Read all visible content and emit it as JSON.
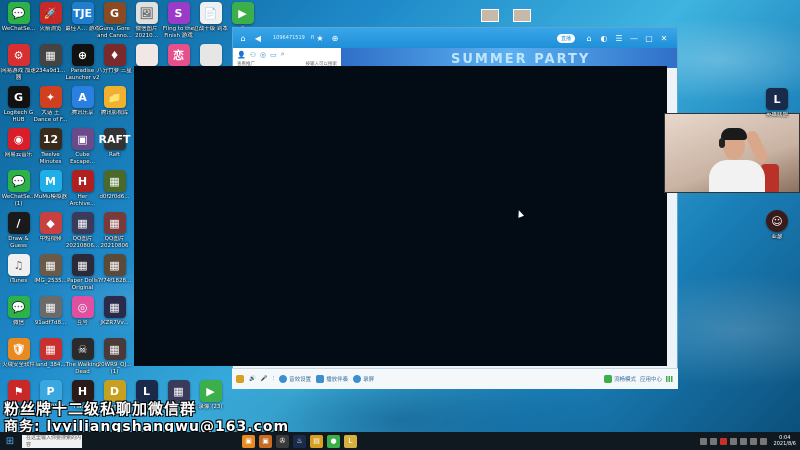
{
  "desktop_icons": [
    {
      "label": "WeChatSe...",
      "color": "#2db24a",
      "glyph": "💬"
    },
    {
      "label": "火箭浏览",
      "color": "#c82828",
      "glyph": "🚀"
    },
    {
      "label": "最佳人... 游戏",
      "color": "#1f7ed0",
      "glyph": "TJE"
    },
    {
      "label": "Guns, Gore and Canno...",
      "color": "#8a4a22",
      "glyph": "G"
    },
    {
      "label": "微信图片 20210...",
      "color": "#e0e0e0",
      "glyph": "🖼"
    },
    {
      "label": "Fling to the Finish 游戏",
      "color": "#9b3cc8",
      "glyph": "S"
    },
    {
      "label": "泣战十级 到本",
      "color": "#f0f0f0",
      "glyph": "📄"
    },
    {
      "label": "录",
      "color": "#3cae4a",
      "glyph": "▶"
    },
    {
      "label": "网易游戏 加速器",
      "color": "#d83030",
      "glyph": "⚙"
    },
    {
      "label": "234a9d1...",
      "color": "#444",
      "glyph": "▦"
    },
    {
      "label": "Paradise Launcher v2",
      "color": "#111",
      "glyph": "⊕"
    },
    {
      "label": "八分竹萝 三星",
      "color": "#7a2a2a",
      "glyph": "♦"
    },
    {
      "label": "",
      "color": "#f2e7e7",
      "glyph": ""
    },
    {
      "label": "",
      "color": "#e8508c",
      "glyph": "恋"
    },
    {
      "label": "",
      "color": "#e6e6e6",
      "glyph": ""
    },
    {
      "label": "Logitech G HUB",
      "color": "#111",
      "glyph": "G"
    },
    {
      "label": "大话 王 Dance of F...",
      "color": "#d04020",
      "glyph": "✦"
    },
    {
      "label": "腾讯乐享",
      "color": "#2b7fe0",
      "glyph": "A"
    },
    {
      "label": "腾讯影视库",
      "color": "#f0b030",
      "glyph": "📁"
    },
    {
      "label": "网易云音乐",
      "color": "#d81e28",
      "glyph": "◉"
    },
    {
      "label": "Twelve Minutes",
      "color": "#3a2a1a",
      "glyph": "12"
    },
    {
      "label": "Cube Escape...",
      "color": "#6a4a8a",
      "glyph": "▣"
    },
    {
      "label": "Raft",
      "color": "#333",
      "glyph": "RAFT"
    },
    {
      "label": "WeChatSe... (1)",
      "color": "#2db24a",
      "glyph": "💬"
    },
    {
      "label": "MuMu模拟器",
      "color": "#1faee8",
      "glyph": "M"
    },
    {
      "label": "Her Archive...",
      "color": "#b02020",
      "glyph": "H"
    },
    {
      "label": "d0f2f0d6...",
      "color": "#4a6a2a",
      "glyph": "▦"
    },
    {
      "label": "Draw & Guess",
      "color": "#1a1a1a",
      "glyph": "/"
    },
    {
      "label": "中短视频",
      "color": "#c84040",
      "glyph": "◆"
    },
    {
      "label": "QQ图片 20210806...",
      "color": "#3a3a5a",
      "glyph": "▦"
    },
    {
      "label": "QQ图片 20210806",
      "color": "#7a3a3a",
      "glyph": "▦"
    },
    {
      "label": "iTunes",
      "color": "#f0f0f0",
      "glyph": "♫"
    },
    {
      "label": "IMG_2535...",
      "color": "#6a5a4a",
      "glyph": "▦"
    },
    {
      "label": "Paper Dolls Original",
      "color": "#2a2a3a",
      "glyph": "▦"
    },
    {
      "label": "7f74f1828...",
      "color": "#5a4a3a",
      "glyph": "▦"
    },
    {
      "label": "微信",
      "color": "#2db24a",
      "glyph": "💬"
    },
    {
      "label": "91adf7d8...",
      "color": "#6a6a6a",
      "glyph": "▦"
    },
    {
      "label": "互号",
      "color": "#e050a0",
      "glyph": "◎"
    },
    {
      "label": "JKZR7Vv...",
      "color": "#2a2a4a",
      "glyph": "▦"
    },
    {
      "label": "火绒安全软件",
      "color": "#e88a20",
      "glyph": "🛡"
    },
    {
      "label": "land_384...",
      "color": "#c83030",
      "glyph": "▦"
    },
    {
      "label": "The Walking Dead",
      "color": "#2a2a2a",
      "glyph": "☠"
    },
    {
      "label": "20WR9_OJ... (1)",
      "color": "#4a3a3a",
      "glyph": "▦"
    },
    {
      "label": "theHunter Call of th...",
      "color": "#c82828",
      "glyph": "⚑"
    },
    {
      "label": "PICO PARK",
      "color": "#3aa8e0",
      "glyph": "P"
    },
    {
      "label": "Hades",
      "color": "#2a1a1a",
      "glyph": "H"
    },
    {
      "label": "Dreamer's Life...",
      "color": "#c8a020",
      "glyph": "D"
    },
    {
      "label": "英雄联盟",
      "color": "#1a2a4a",
      "glyph": "L"
    },
    {
      "label": "011521s1...",
      "color": "#3a3a5a",
      "glyph": "▦"
    },
    {
      "label": "录像 (23)",
      "color": "#3cae4a",
      "glyph": "▶"
    }
  ],
  "app_window": {
    "title_text": "1096471519",
    "title_text2": "fl",
    "pill": "直播",
    "left_tab": "我的帐号",
    "left_sub_1": "查看推广",
    "left_sub_2": "按输入可以搜索",
    "banner_text": "SUMMER PARTY"
  },
  "bottom_bar": {
    "items": [
      "音效设置",
      "播放伴奏",
      "录屏"
    ],
    "quality": "流畅模式",
    "app_label": "应用中心"
  },
  "right_icons": [
    {
      "label": "英雄联盟",
      "color": "#1a2a4a",
      "glyph": "L"
    },
    {
      "label": "亚瑟",
      "color": "#3a1a1a",
      "glyph": "☺"
    }
  ],
  "overlay_text": {
    "line1": "粉丝牌十二级私聊加微信群",
    "line2": "商务: lvyiliangshangwu@163.com"
  },
  "taskbar": {
    "search_placeholder": "在这里输入你要搜索的内容",
    "time": "0:04",
    "date": "2021/8/6"
  }
}
